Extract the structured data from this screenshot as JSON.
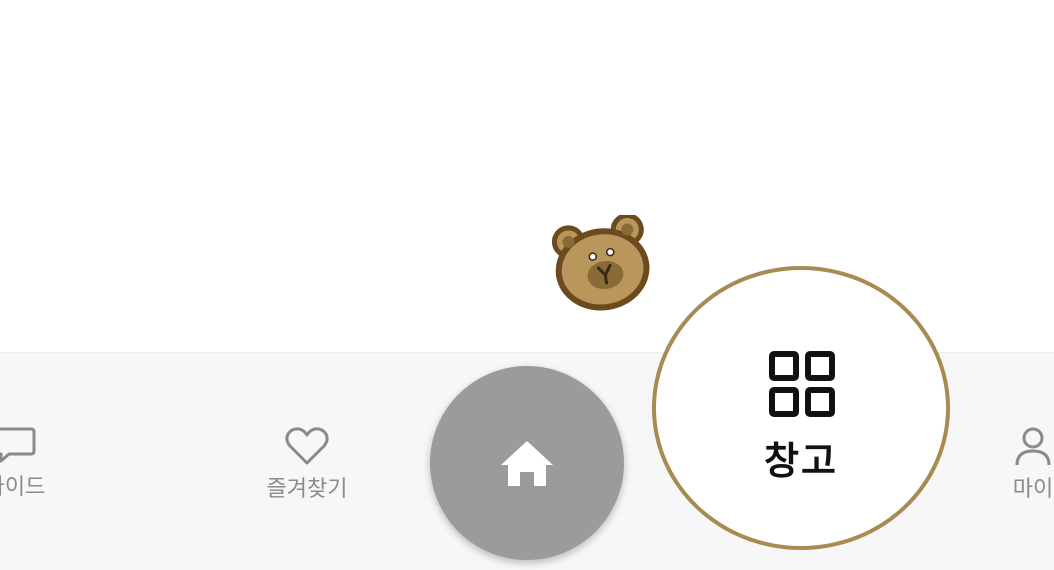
{
  "tab_bar": {
    "guide_label": "가이드",
    "favorites_label": "즐겨찾기",
    "my_label": "마이"
  },
  "home": {
    "icon": "home-icon"
  },
  "storage_tooltip": {
    "label": "창고",
    "icon": "grid-icon"
  },
  "mascot": {
    "icon": "bear-icon"
  },
  "colors": {
    "tab_bar_bg": "#f7f7f7",
    "home_button_bg": "#9b9b9b",
    "bubble_border": "#a88b52",
    "tab_text": "#8a8a8a"
  }
}
